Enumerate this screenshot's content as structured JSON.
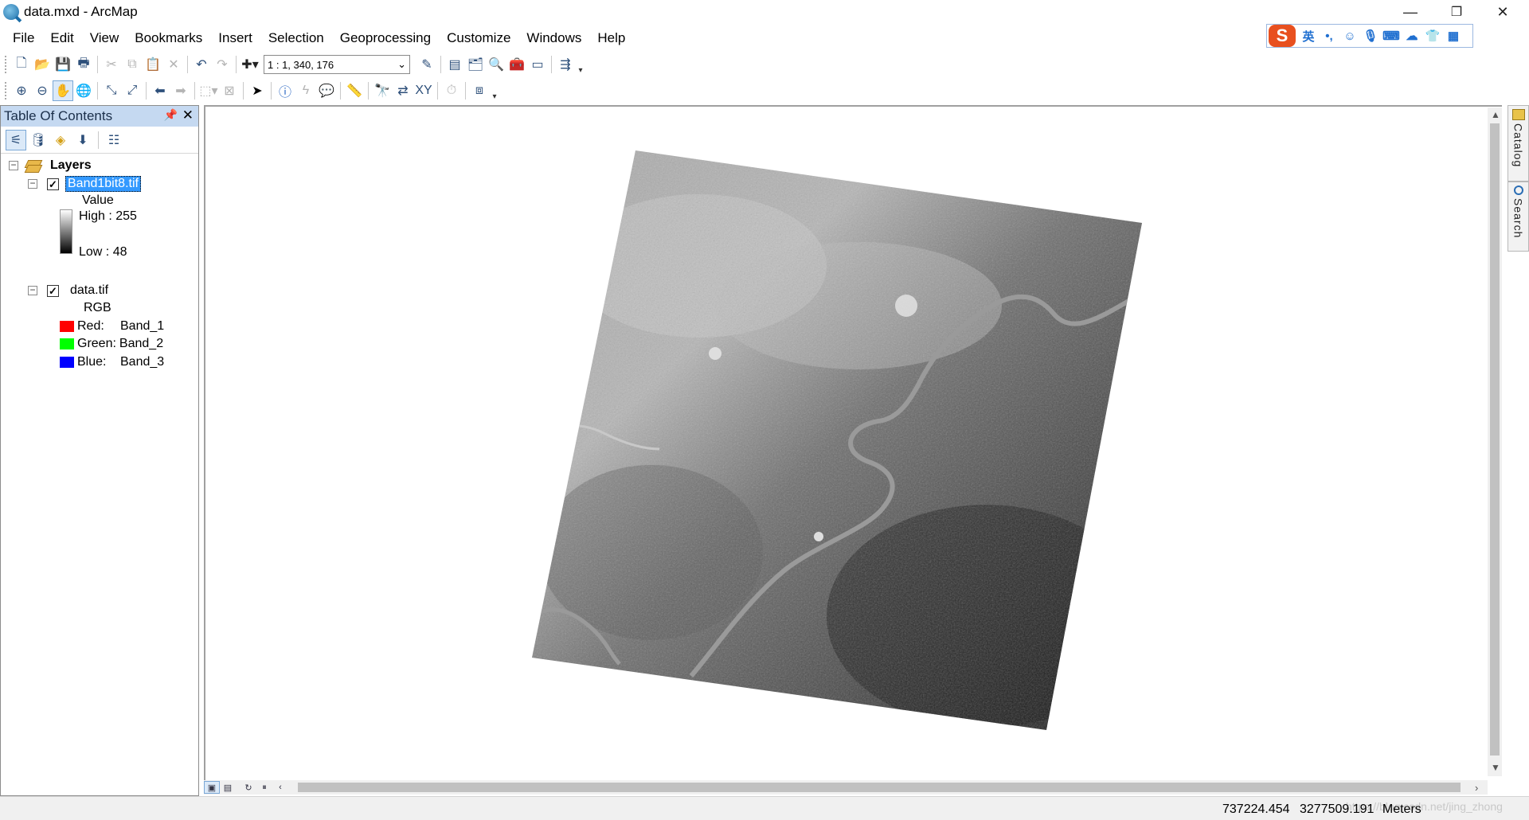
{
  "window": {
    "title": "data.mxd - ArcMap",
    "minimize": "—",
    "restore": "❐",
    "close": "✕"
  },
  "menu": [
    "File",
    "Edit",
    "View",
    "Bookmarks",
    "Insert",
    "Selection",
    "Geoprocessing",
    "Customize",
    "Windows",
    "Help"
  ],
  "ime": {
    "logo": "S",
    "lang": "英",
    "icons": [
      "punctuation-icon",
      "emoji-icon",
      "microphone-icon",
      "keyboard-icon",
      "skin-icon",
      "shirt-icon",
      "grid-icon"
    ]
  },
  "toolbar": {
    "scale": "1 : 1, 340, 176"
  },
  "toc": {
    "title": "Table Of Contents",
    "root": "Layers",
    "layer1": {
      "name": "Band1bit8.tif",
      "checked": "✓",
      "legend_heading": "Value",
      "high": "High : 255",
      "low": "Low : 48"
    },
    "layer2": {
      "name": "data.tif",
      "checked": "✓",
      "legend_heading": "RGB",
      "bands": [
        {
          "label": "Red:",
          "band": "Band_1",
          "color": "#ff0000"
        },
        {
          "label": "Green:",
          "band": "Band_2",
          "color": "#00ff00"
        },
        {
          "label": "Blue:",
          "band": "Band_3",
          "color": "#0000ff"
        }
      ]
    }
  },
  "dock": {
    "catalog": "Catalog",
    "search": "Search"
  },
  "status": {
    "x": "737224.454",
    "y": "3277509.191",
    "units": "Meters",
    "watermark": "https://blog.csdn.net/jing_zhong"
  },
  "colors": {
    "toc_header": "#c5d9f1",
    "selection": "#3399ff"
  }
}
